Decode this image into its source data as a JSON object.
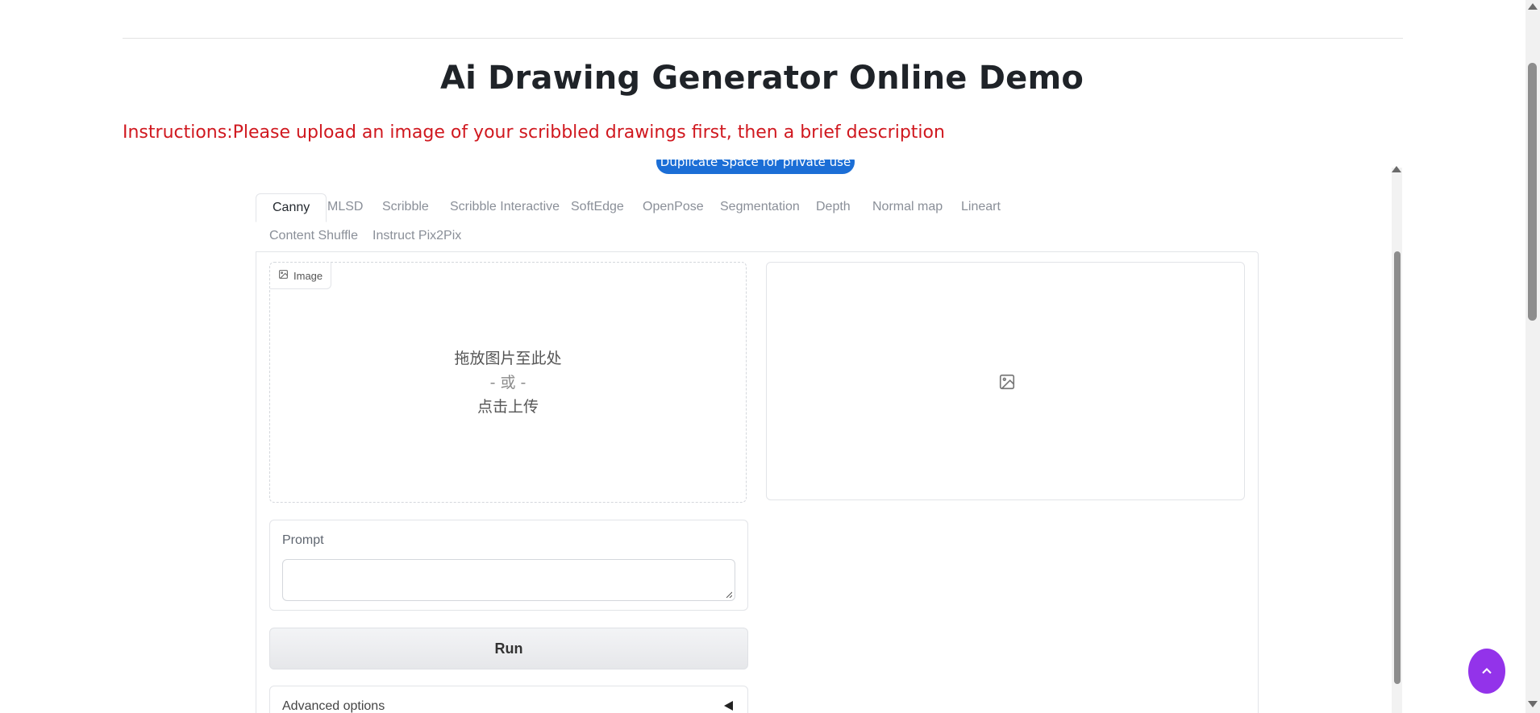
{
  "page": {
    "title": "Ai Drawing Generator Online Demo",
    "instructions": "Instructions:Please upload an image of your scribbled drawings first, then a brief description"
  },
  "space": {
    "duplicate_label": "Duplicate Space for private use"
  },
  "tabs": [
    {
      "label": "Canny",
      "active": true
    },
    {
      "label": "MLSD"
    },
    {
      "label": "Scribble"
    },
    {
      "label": "Scribble Interactive"
    },
    {
      "label": "SoftEdge"
    },
    {
      "label": "OpenPose"
    },
    {
      "label": "Segmentation"
    },
    {
      "label": "Depth"
    },
    {
      "label": "Normal map"
    },
    {
      "label": "Lineart"
    },
    {
      "label": "Content Shuffle"
    },
    {
      "label": "Instruct Pix2Pix"
    }
  ],
  "upload": {
    "label": "Image",
    "drop_line1": "拖放图片至此处",
    "drop_or": "- 或 -",
    "drop_line2": "点击上传"
  },
  "prompt": {
    "label": "Prompt",
    "value": ""
  },
  "run_label": "Run",
  "advanced_label": "Advanced options",
  "colors": {
    "instructions": "#d0181f",
    "duplicate_button": "#1b6ed6",
    "fab": "#9333ea"
  },
  "icons": {
    "image_label": "image-icon",
    "output_placeholder": "image-icon",
    "fab": "chevron-up-icon",
    "advanced": "caret-left-icon"
  }
}
